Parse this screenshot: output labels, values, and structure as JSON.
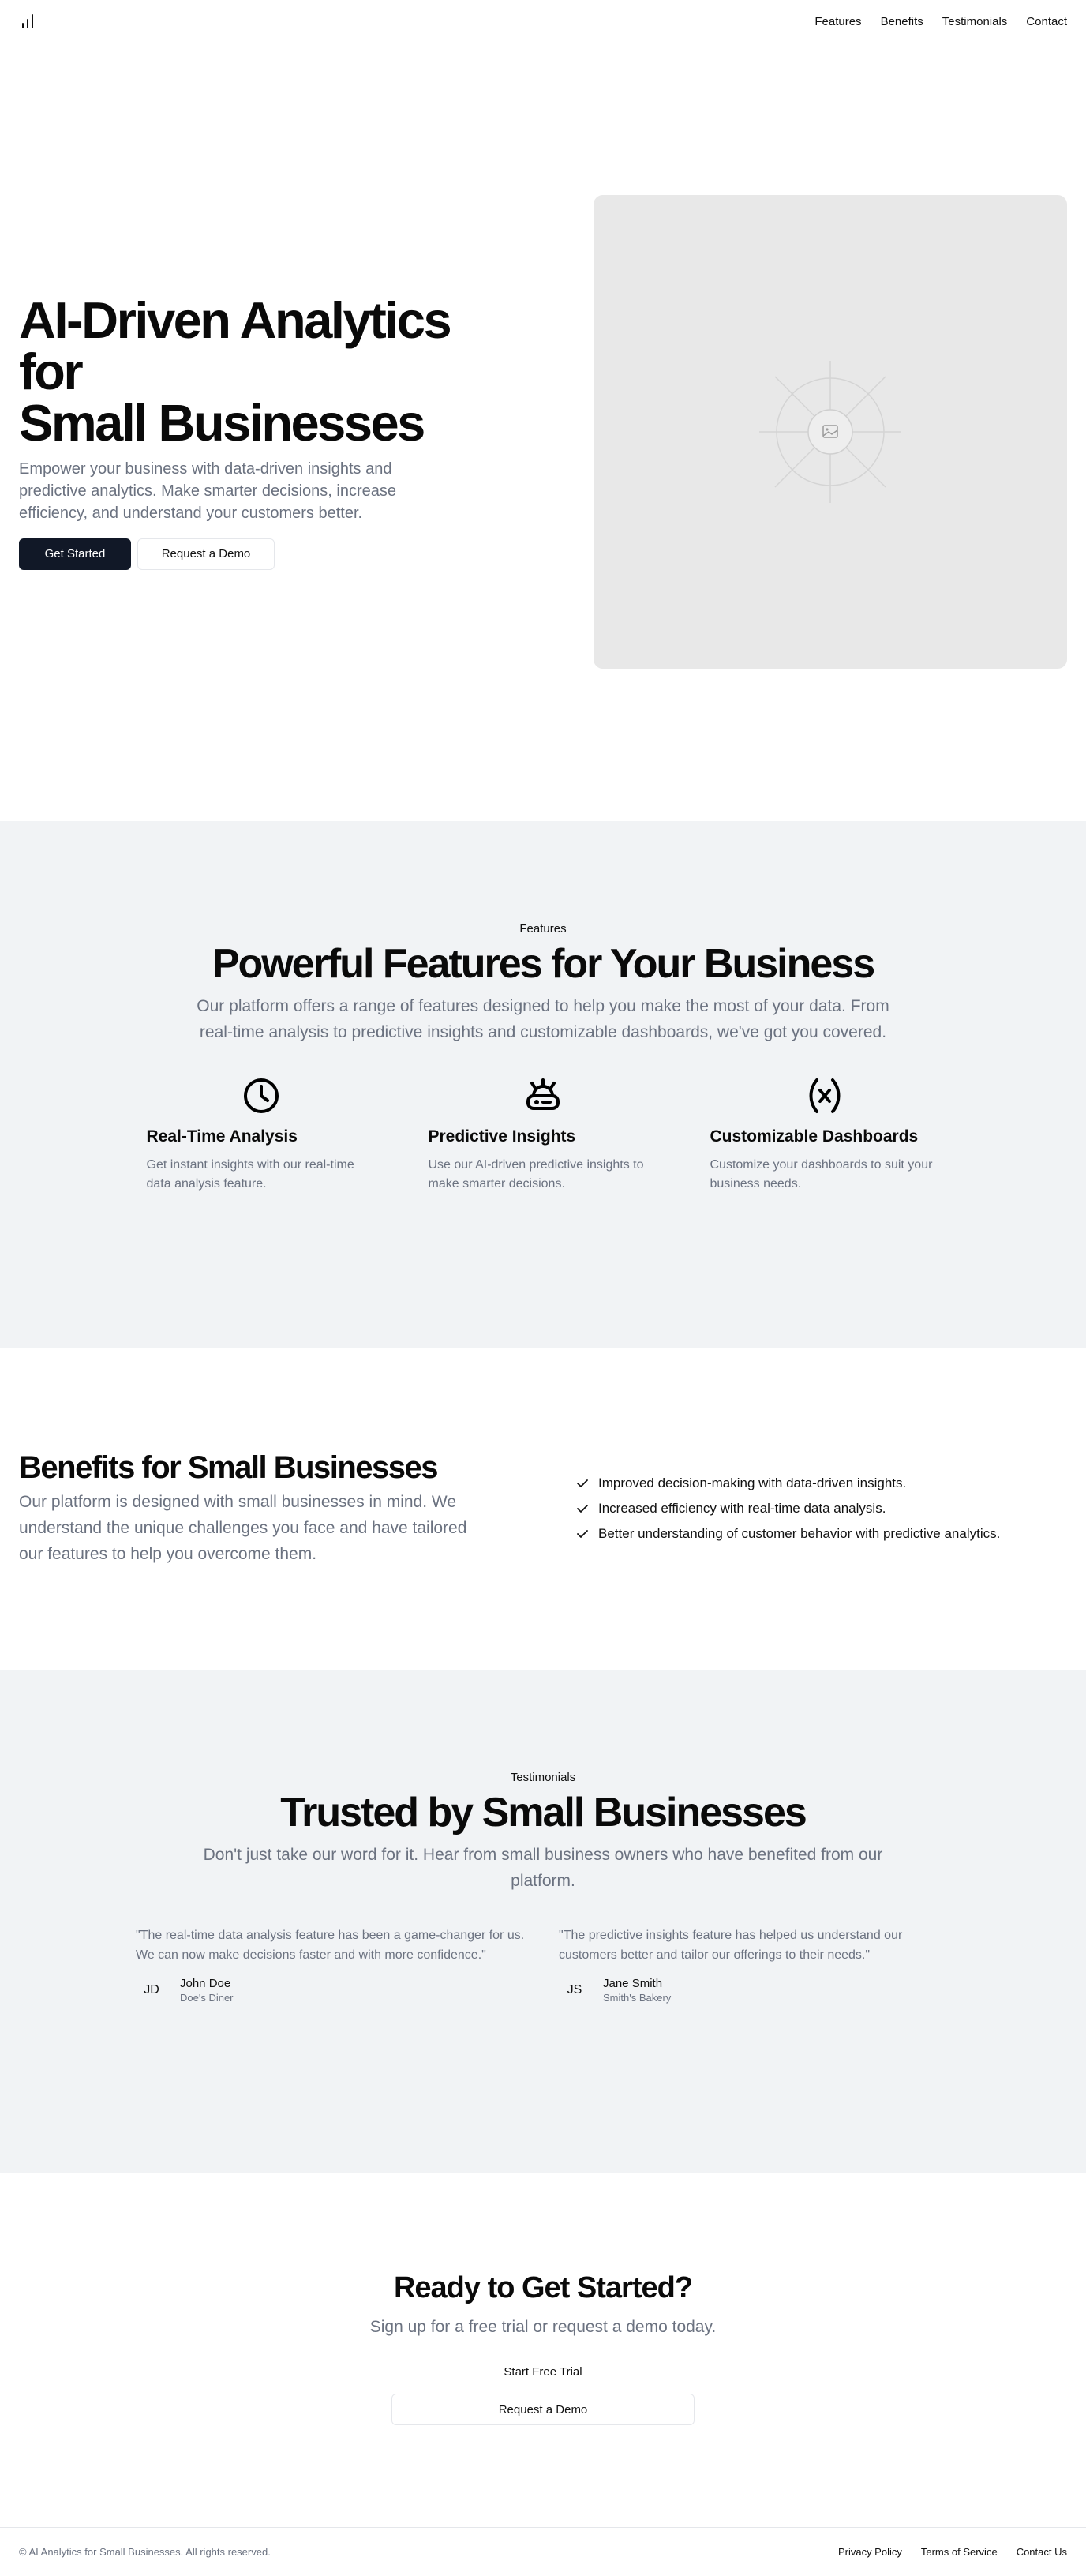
{
  "nav": {
    "items": [
      {
        "label": "Features"
      },
      {
        "label": "Benefits"
      },
      {
        "label": "Testimonials"
      },
      {
        "label": "Contact"
      }
    ]
  },
  "hero": {
    "title_line1": "AI-Driven Analytics for",
    "title_line2": "Small Businesses",
    "subtitle": "Empower your business with data-driven insights and predictive analytics. Make smarter decisions, increase efficiency, and understand your customers better.",
    "primary_button": "Get Started",
    "secondary_button": "Request a Demo",
    "image_icon": "image-placeholder-icon"
  },
  "features": {
    "eyebrow": "Features",
    "title": "Powerful Features for Your Business",
    "subtitle": "Our platform offers a range of features designed to help you make the most of your data. From real-time analysis to predictive insights and customizable dashboards, we've got you covered.",
    "items": [
      {
        "icon": "clock-icon",
        "title": "Real-Time Analysis",
        "description": "Get instant insights with our real-time data analysis feature."
      },
      {
        "icon": "insights-icon",
        "title": "Predictive Insights",
        "description": "Use our AI-driven predictive insights to make smarter decisions."
      },
      {
        "icon": "variable-icon",
        "title": "Customizable Dashboards",
        "description": "Customize your dashboards to suit your business needs."
      }
    ]
  },
  "benefits": {
    "title": "Benefits for Small Businesses",
    "subtitle": "Our platform is designed with small businesses in mind. We understand the unique challenges you face and have tailored our features to help you overcome them.",
    "items": [
      {
        "label": "Improved decision-making with data-driven insights."
      },
      {
        "label": "Increased efficiency with real-time data analysis."
      },
      {
        "label": "Better understanding of customer behavior with predictive analytics."
      }
    ]
  },
  "testimonials": {
    "eyebrow": "Testimonials",
    "title": "Trusted by Small Businesses",
    "subtitle": "Don't just take our word for it. Hear from small business owners who have benefited from our platform.",
    "items": [
      {
        "quote": "\"The real-time data analysis feature has been a game-changer for us. We can now make decisions faster and with more confidence.\"",
        "initials": "JD",
        "name": "John Doe",
        "company": "Doe's Diner"
      },
      {
        "quote": "\"The predictive insights feature has helped us understand our customers better and tailor our offerings to their needs.\"",
        "initials": "JS",
        "name": "Jane Smith",
        "company": "Smith's Bakery"
      }
    ]
  },
  "cta": {
    "title": "Ready to Get Started?",
    "subtitle": "Sign up for a free trial or request a demo today.",
    "trial_button": "Start Free Trial",
    "demo_button": "Request a Demo"
  },
  "footer": {
    "copyright": "© AI Analytics for Small Businesses. All rights reserved.",
    "links": [
      {
        "label": "Privacy Policy"
      },
      {
        "label": "Terms of Service"
      },
      {
        "label": "Contact Us"
      }
    ]
  },
  "colors": {
    "primary": "#111827",
    "muted_text": "#6b7280",
    "section_bg": "#f1f3f5",
    "placeholder_bg": "#e8e8e8"
  }
}
